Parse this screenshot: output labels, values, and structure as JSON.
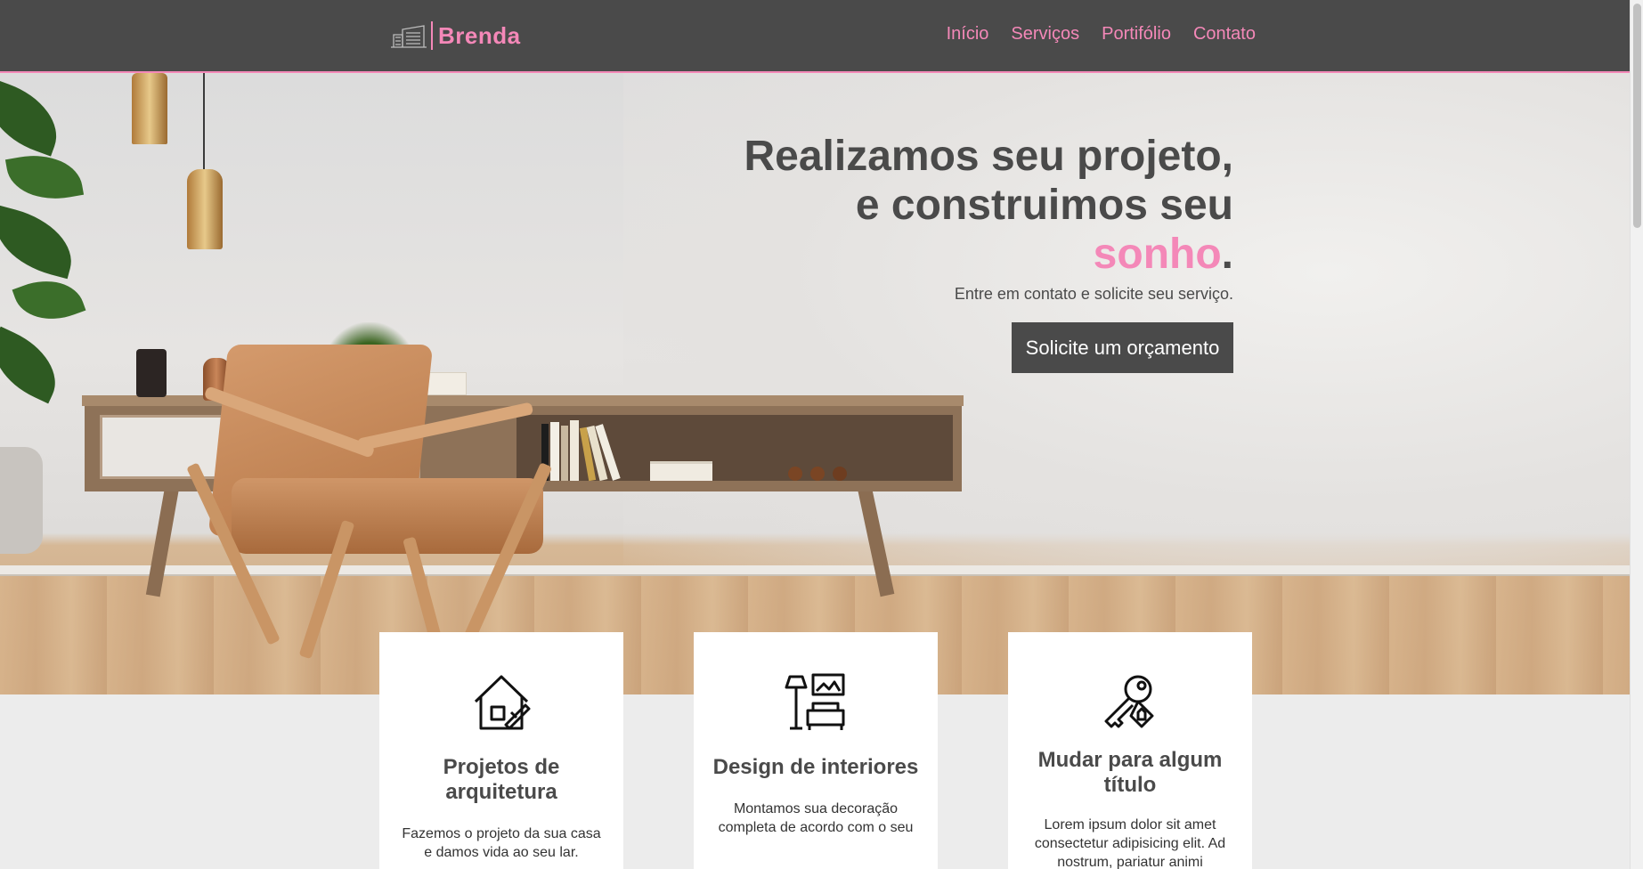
{
  "header": {
    "logo_text": "Brenda",
    "nav": [
      "Início",
      "Serviços",
      "Portifólio",
      "Contato"
    ]
  },
  "hero": {
    "title_line1": "Realizamos seu projeto,",
    "title_line2": "e construimos seu",
    "title_accent": "sonho",
    "title_end": ".",
    "subtitle": "Entre em contato e solicite seu serviço.",
    "cta_label": "Solicite um orçamento"
  },
  "cards": [
    {
      "icon": "architecture-house-icon",
      "title": "Projetos de arquitetura",
      "text": "Fazemos o projeto da sua casa e damos vida ao seu lar."
    },
    {
      "icon": "interior-sofa-lamp-icon",
      "title": "Design de interiores",
      "text": "Montamos sua decoração completa de acordo com o seu"
    },
    {
      "icon": "keys-house-icon",
      "title": "Mudar para algum título",
      "text": "Lorem ipsum dolor sit amet consectetur adipisicing elit. Ad nostrum, pariatur animi"
    }
  ],
  "colors": {
    "accent": "#f488b8",
    "dark": "#4a4a4a",
    "background": "#ececec"
  }
}
